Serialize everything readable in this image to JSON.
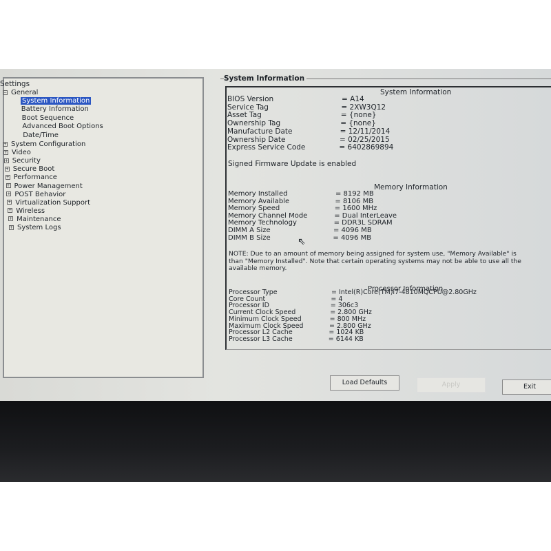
{
  "tree": {
    "root": "Settings",
    "general": "General",
    "general_items": [
      "System Information",
      "Battery Information",
      "Boot Sequence",
      "Advanced Boot Options",
      "Date/Time"
    ],
    "selected": "System Information",
    "groups": [
      "System Configuration",
      "Video",
      "Security",
      "Secure Boot",
      "Performance",
      "Power Management",
      "POST Behavior",
      "Virtualization Support",
      "Wireless",
      "Maintenance",
      "System Logs"
    ]
  },
  "panel": {
    "title": "System Information",
    "system_heading": "System Information",
    "system_rows": [
      {
        "label": "BIOS Version",
        "value": "= A14"
      },
      {
        "label": "Service Tag",
        "value": "= 2XW3Q12"
      },
      {
        "label": "Asset Tag",
        "value": "= {none}"
      },
      {
        "label": "Ownership Tag",
        "value": "= {none}"
      },
      {
        "label": "Manufacture Date",
        "value": "= 12/11/2014"
      },
      {
        "label": "Ownership Date",
        "value": "= 02/25/2015"
      },
      {
        "label": "Express Service Code",
        "value": "= 6402869894"
      }
    ],
    "firmware_note": "Signed Firmware Update is enabled",
    "memory_heading": "Memory Information",
    "memory_rows": [
      {
        "label": "Memory Installed",
        "value": "= 8192 MB"
      },
      {
        "label": "Memory Available",
        "value": "= 8106 MB"
      },
      {
        "label": "Memory Speed",
        "value": "= 1600 MHz"
      },
      {
        "label": "Memory Channel Mode",
        "value": "= Dual InterLeave"
      },
      {
        "label": "Memory Technology",
        "value": "= DDR3L SDRAM"
      },
      {
        "label": "DIMM A Size",
        "value": "= 4096 MB"
      },
      {
        "label": "DIMM B Size",
        "value": "= 4096 MB"
      }
    ],
    "note_lines": [
      "NOTE: Due to an amount of memory being assigned for system use, \"Memory Available\" is",
      "than \"Memory Installed\". Note that certain operating systems may not be able to use all the",
      "available memory."
    ],
    "processor_heading": "Processor Information",
    "processor_rows": [
      {
        "label": "Processor Type",
        "value": "= Intel(R)Core(TM)i7-4810MQCPU@2.80GHz"
      },
      {
        "label": "Core Count",
        "value": "= 4"
      },
      {
        "label": "Processor ID",
        "value": "= 306c3"
      },
      {
        "label": "Current Clock Speed",
        "value": "= 2.800 GHz"
      },
      {
        "label": "Minimum Clock Speed",
        "value": "= 800 MHz"
      },
      {
        "label": "Maximum Clock Speed",
        "value": "= 2.800 GHz"
      },
      {
        "label": "Processor L2 Cache",
        "value": "= 1024 KB"
      },
      {
        "label": "Processor L3 Cache",
        "value": "= 6144 KB"
      }
    ]
  },
  "buttons": {
    "load_defaults": "Load Defaults",
    "apply": "Apply",
    "exit": "Exit"
  }
}
